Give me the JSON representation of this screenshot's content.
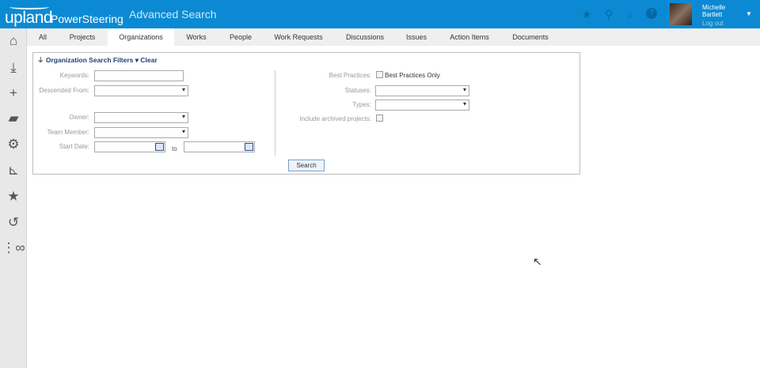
{
  "header": {
    "logo_text": "upland",
    "product": "PowerSteering",
    "page_title": "Advanced Search",
    "user": {
      "first": "Michelle",
      "last": "Bartlett",
      "logout": "Log out"
    },
    "icons": [
      "star-icon",
      "location-pin-icon",
      "search-icon",
      "help-icon"
    ]
  },
  "sidebar": {
    "icons": [
      "home-icon",
      "download-money-icon",
      "plus-icon",
      "folder-user-icon",
      "gear-icon",
      "chart-icon",
      "star-icon",
      "history-icon",
      "timeline-icon"
    ]
  },
  "tabs": [
    "All",
    "Projects",
    "Organizations",
    "Works",
    "People",
    "Work Requests",
    "Discussions",
    "Issues",
    "Action Items",
    "Documents"
  ],
  "active_tab": "Organizations",
  "filters": {
    "title": "Organization Search Filters",
    "clear": "Clear",
    "keywords": "Keywords:",
    "keywords_value": "",
    "descended_from": "Descended From:",
    "owner": "Owner:",
    "team_member": "Team Member:",
    "start_date": "Start Date:",
    "to": "to",
    "best_practices": "Best Practices:",
    "best_practices_only": "Best Practices Only",
    "statuses": "Statuses:",
    "types": "Types:",
    "include_archived": "Include archived projects:",
    "search": "Search"
  },
  "colors": {
    "header": "#0b8ad3",
    "filter_title": "#1e3f73"
  }
}
